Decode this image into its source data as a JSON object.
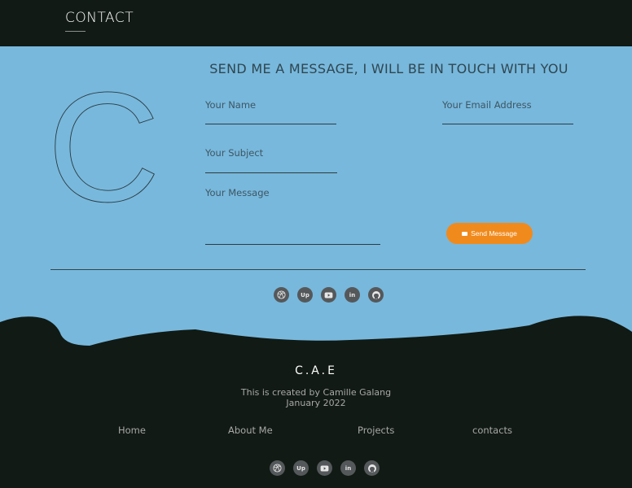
{
  "header": {
    "title": "CONTACT"
  },
  "contact": {
    "heading": "SEND ME A MESSAGE, I WILL BE IN TOUCH WITH YOU",
    "logo_letter": "C",
    "name_label": "Your Name",
    "email_label": "Your Email Address",
    "subject_label": "Your Subject",
    "message_label": "Your Message",
    "send_label": "Send Message"
  },
  "social": [
    {
      "icon": "dribbble-icon"
    },
    {
      "icon": "upwork-icon",
      "text": "Up"
    },
    {
      "icon": "youtube-icon"
    },
    {
      "icon": "linkedin-icon",
      "text": "in"
    },
    {
      "icon": "github-icon"
    }
  ],
  "footer": {
    "brand": "C.A.E",
    "credit_line1": "This is created by Camille Galang",
    "credit_line2": "January 2022",
    "nav": [
      "Home",
      "About Me",
      "Projects",
      "contacts"
    ]
  },
  "colors": {
    "dark": "#111a14",
    "blue": "#78b8dc",
    "accent": "#f18a1c"
  }
}
